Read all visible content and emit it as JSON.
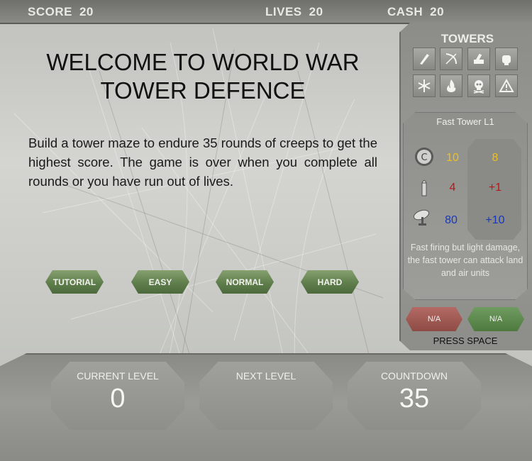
{
  "hud": {
    "score_label": "SCORE",
    "score": "20",
    "lives_label": "LIVES",
    "lives": "20",
    "cash_label": "CASH",
    "cash": "20"
  },
  "welcome": {
    "title": "WELCOME TO WORLD WAR TOWER DEFENCE",
    "intro": "Build a tower maze to endure 35 rounds of creeps to get the highest score. The game is over when you complete all rounds or you have run out of lives."
  },
  "difficulty": {
    "tutorial": "TUTORIAL",
    "easy": "EASY",
    "normal": "NORMAL",
    "hard": "HARD"
  },
  "towers_panel": {
    "title": "TOWERS",
    "icons": [
      "bullet-tower-icon",
      "bow-tower-icon",
      "cannon-tower-icon",
      "fist-tower-icon",
      "snowflake-tower-icon",
      "fire-tower-icon",
      "skull-tower-icon",
      "warning-tower-icon"
    ]
  },
  "tower_info": {
    "name": "Fast Tower L1",
    "cost": "10",
    "cost_upgrade": "8",
    "damage": "4",
    "damage_upgrade": "+1",
    "range": "80",
    "range_upgrade": "+10",
    "description": "Fast firing but light damage, the fast tower can attack land and air units",
    "sell_label": "N/A",
    "upgrade_label": "N/A",
    "hint": "PRESS SPACE"
  },
  "levels": {
    "current_label": "CURRENT LEVEL",
    "current_value": "0",
    "next_label": "NEXT LEVEL",
    "next_value": "",
    "countdown_label": "COUNTDOWN",
    "countdown_value": "35"
  },
  "colors": {
    "difficulty_button": "#5f7e4c",
    "sell_button": "#8e4b45",
    "upgrade_button": "#4e7a40",
    "cost_text": "#f0c020",
    "damage_text": "#b81818",
    "range_text": "#1838b8"
  }
}
